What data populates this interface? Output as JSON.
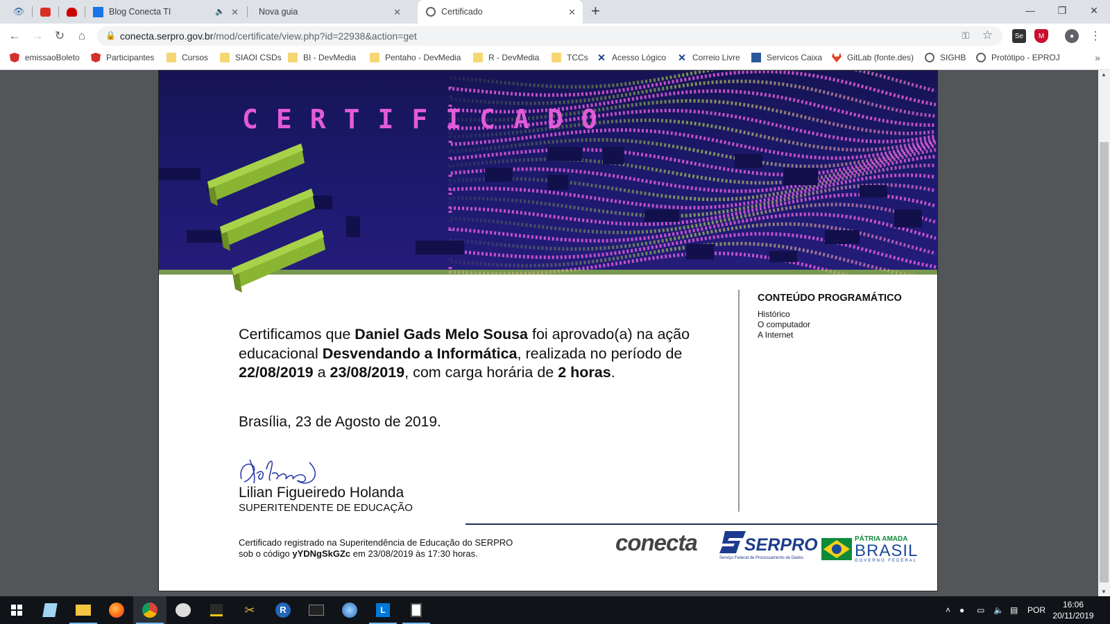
{
  "tabs": [
    {
      "title": "Blog Conecta TI"
    },
    {
      "title": "Nova guia"
    },
    {
      "title": "Certificado"
    }
  ],
  "address": {
    "host": "conecta.serpro.gov.br",
    "path": "/mod/certificate/view.php?id=22938&action=get"
  },
  "bookmarks": [
    {
      "label": "emissaoBoleto",
      "icon": "angular-icon"
    },
    {
      "label": "Participantes",
      "icon": "angular-icon"
    },
    {
      "label": "Cursos",
      "icon": "folder-icon"
    },
    {
      "label": "SIAOI CSDs",
      "icon": "folder-icon"
    },
    {
      "label": "BI - DevMedia",
      "icon": "folder-icon"
    },
    {
      "label": "Pentaho - DevMedia",
      "icon": "folder-icon"
    },
    {
      "label": "R - DevMedia",
      "icon": "folder-icon"
    },
    {
      "label": "TCCs",
      "icon": "folder-icon"
    },
    {
      "label": "Acesso Lógico",
      "icon": "x-icon"
    },
    {
      "label": "Correio Livre",
      "icon": "x-icon"
    },
    {
      "label": "Servicos Caixa",
      "icon": "caixa-icon"
    },
    {
      "label": "GitLab (fonte.des)",
      "icon": "gitlab-icon"
    },
    {
      "label": "SIGHB",
      "icon": "globe-icon"
    },
    {
      "label": "Protótipo - EPROJ",
      "icon": "globe-icon"
    }
  ],
  "certificate": {
    "banner_title": "CERTIFICADO",
    "t1": "Certificamos que ",
    "name": "Daniel Gads Melo Sousa",
    "t2": " foi aprovado(a) na ação educacional ",
    "course": "Desvendando a Informática",
    "t3": ", realizada no período de ",
    "date_start": "22/08/2019",
    "t4": " a ",
    "date_end": "23/08/2019",
    "t5": ", com carga horária de ",
    "hours": "2 horas",
    "t6": ".",
    "place_date": "Brasília, 23 de Agosto de 2019.",
    "signer": "Lilian Figueiredo Holanda",
    "role": "SUPERITENDENTE DE EDUCAÇÃO",
    "program_title": "CONTEÚDO PROGRAMÁTICO",
    "program_items": [
      "Histórico",
      "O computador",
      "A Internet"
    ],
    "reg_line1": "Certificado registrado na Superitendência de Educação do SERPRO",
    "reg_line2a": "sob o código ",
    "reg_code": "yYDNgSkGZc",
    "reg_line2b": " em 23/08/2019 às 17:30 horas.",
    "logo_conecta": "conecta",
    "logo_serpro": "SERPRO",
    "logo_serpro_sub": "Serviço Federal de Processamento de Dados",
    "logo_patria": "PÁTRIA AMADA",
    "logo_brasil": "BRASIL",
    "logo_gov": "GOVERNO FEDERAL"
  },
  "taskbar": {
    "lang": "POR",
    "time": "16:06",
    "date": "20/11/2019"
  },
  "colors": {
    "banner_dark": "#1c1a6e",
    "banner_magenta": "#e25bd8",
    "banner_green": "#9cce3f",
    "serpro_blue": "#1d3b8e"
  }
}
